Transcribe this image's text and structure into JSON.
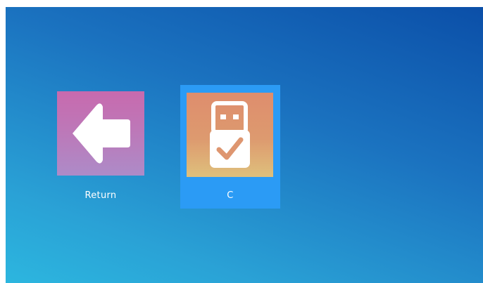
{
  "desktop": {
    "background": [
      "#0b4fa8",
      "#2cb6df"
    ],
    "items": [
      {
        "label": "Return",
        "icon": "back-arrow-icon",
        "tint": "#c070b4",
        "selected": false
      },
      {
        "label": "C",
        "icon": "usb-drive-icon",
        "tint": "#de9670",
        "selected": true
      }
    ],
    "selection_color": "#2b9bf5"
  }
}
